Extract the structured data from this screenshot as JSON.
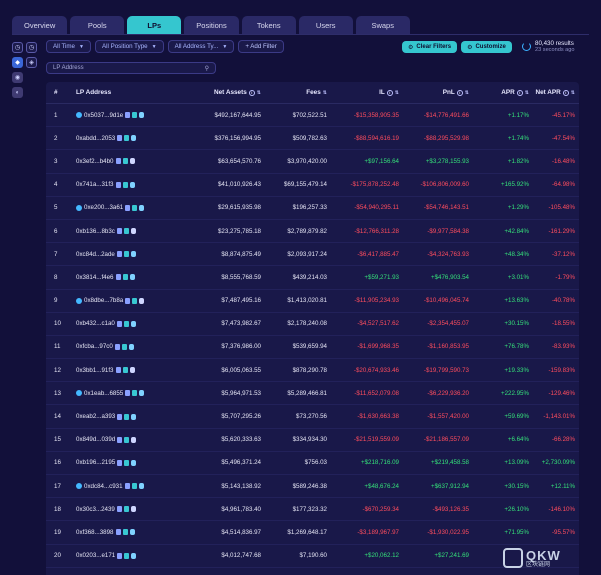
{
  "tabs": [
    "Overview",
    "Pools",
    "LPs",
    "Positions",
    "Tokens",
    "Users",
    "Swaps"
  ],
  "active_tab": "LPs",
  "filters": {
    "time": "All Time",
    "position_type": "All Position Type",
    "address_type": "All Address Ty...",
    "add_filter": "+ Add Filter",
    "clear": "Clear Filters",
    "customize": "Customize"
  },
  "results": {
    "count": "80,430 results",
    "ago": "23 seconds ago"
  },
  "search": {
    "placeholder": "LP Address"
  },
  "table": {
    "headers": {
      "num": "#",
      "addr": "LP Address",
      "net": "Net Assets",
      "fees": "Fees",
      "il": "IL",
      "pnl": "PnL",
      "apr": "APR",
      "napr": "Net APR"
    },
    "rows": [
      {
        "n": "1",
        "addr": "0x5037...9d1e",
        "net": "$492,167,644.95",
        "fees": "$702,522.51",
        "il": "-$15,358,905.35",
        "pnl": "-$14,776,491.66",
        "apr": "+1.17%",
        "napr": "-45.17%"
      },
      {
        "n": "2",
        "addr": "0xabdd...2053",
        "net": "$376,156,994.95",
        "fees": "$509,782.63",
        "il": "-$88,594,616.19",
        "pnl": "-$88,295,529.98",
        "apr": "+1.74%",
        "napr": "-47.54%"
      },
      {
        "n": "3",
        "addr": "0x3ef2...b4b0",
        "net": "$63,654,570.76",
        "fees": "$3,970,420.00",
        "il": "+$97,156.64",
        "pnl": "+$3,278,155.93",
        "apr": "+1.82%",
        "napr": "-16.48%"
      },
      {
        "n": "4",
        "addr": "0x741a...31f3",
        "net": "$41,010,926.43",
        "fees": "$69,155,479.14",
        "il": "-$175,878,252.48",
        "pnl": "-$106,806,009.60",
        "apr": "+165.92%",
        "napr": "-64.98%"
      },
      {
        "n": "5",
        "addr": "0xe200...3a61",
        "net": "$29,615,935.98",
        "fees": "$196,257.33",
        "il": "-$54,940,295.11",
        "pnl": "-$54,746,143.51",
        "apr": "+1.29%",
        "napr": "-105.48%"
      },
      {
        "n": "6",
        "addr": "0xb136...8b3c",
        "net": "$23,275,785.18",
        "fees": "$2,789,879.82",
        "il": "-$12,766,311.28",
        "pnl": "-$9,977,584.38",
        "apr": "+42.84%",
        "napr": "-161.29%"
      },
      {
        "n": "7",
        "addr": "0xc84d...2ade",
        "net": "$8,874,875.49",
        "fees": "$2,093,917.24",
        "il": "-$6,417,885.47",
        "pnl": "-$4,324,763.93",
        "apr": "+48.34%",
        "napr": "-37.12%"
      },
      {
        "n": "8",
        "addr": "0x3814...f4e6",
        "net": "$8,555,768.59",
        "fees": "$439,214.03",
        "il": "+$59,271.93",
        "pnl": "+$476,903.54",
        "apr": "+3.01%",
        "napr": "-1.79%"
      },
      {
        "n": "9",
        "addr": "0x8dbe...7b8a",
        "net": "$7,487,495.16",
        "fees": "$1,413,020.81",
        "il": "-$11,905,234.93",
        "pnl": "-$10,496,045.74",
        "apr": "+13.63%",
        "napr": "-40.78%"
      },
      {
        "n": "10",
        "addr": "0xb432...c1a0",
        "net": "$7,473,982.67",
        "fees": "$2,178,240.08",
        "il": "-$4,527,517.62",
        "pnl": "-$2,354,455.07",
        "apr": "+30.15%",
        "napr": "-18.55%"
      },
      {
        "n": "11",
        "addr": "0xfcba...97c0",
        "net": "$7,376,986.00",
        "fees": "$539,659.94",
        "il": "-$1,699,968.35",
        "pnl": "-$1,160,853.95",
        "apr": "+76.78%",
        "napr": "-83.93%"
      },
      {
        "n": "12",
        "addr": "0x3bb1...91f3",
        "net": "$6,005,063.55",
        "fees": "$878,290.78",
        "il": "-$20,674,933.46",
        "pnl": "-$19,799,590.73",
        "apr": "+19.33%",
        "napr": "-159.83%"
      },
      {
        "n": "13",
        "addr": "0x1eab...6855",
        "net": "$5,964,971.53",
        "fees": "$5,289,466.81",
        "il": "-$11,652,079.08",
        "pnl": "-$6,229,936.20",
        "apr": "+222.95%",
        "napr": "-129.46%"
      },
      {
        "n": "14",
        "addr": "0xeab2...a393",
        "net": "$5,707,295.26",
        "fees": "$73,270.56",
        "il": "-$1,630,663.38",
        "pnl": "-$1,557,420.00",
        "apr": "+59.69%",
        "napr": "-1,143.01%"
      },
      {
        "n": "15",
        "addr": "0x849d...039d",
        "net": "$5,620,333.63",
        "fees": "$334,934.30",
        "il": "-$21,519,559.09",
        "pnl": "-$21,186,557.09",
        "apr": "+6.64%",
        "napr": "-66.28%"
      },
      {
        "n": "16",
        "addr": "0xb196...2195",
        "net": "$5,496,371.24",
        "fees": "$756.03",
        "il": "+$218,716.09",
        "pnl": "+$219,458.58",
        "apr": "+13.09%",
        "napr": "+2,730.09%"
      },
      {
        "n": "17",
        "addr": "0xdc84...c931",
        "net": "$5,143,138.92",
        "fees": "$589,246.38",
        "il": "+$48,676.24",
        "pnl": "+$637,912.94",
        "apr": "+30.15%",
        "napr": "+12.11%"
      },
      {
        "n": "18",
        "addr": "0x30c3...2439",
        "net": "$4,961,783.40",
        "fees": "$177,323.32",
        "il": "-$670,259.34",
        "pnl": "-$493,126.35",
        "apr": "+26.10%",
        "napr": "-146.10%"
      },
      {
        "n": "19",
        "addr": "0xf368...3898",
        "net": "$4,514,836.97",
        "fees": "$1,269,648.17",
        "il": "-$3,189,967.97",
        "pnl": "-$1,930,022.95",
        "apr": "+71.95%",
        "napr": "-95.57%"
      },
      {
        "n": "20",
        "addr": "0x0203...e171",
        "net": "$4,012,747.68",
        "fees": "$7,190.60",
        "il": "+$20,062.12",
        "pnl": "+$27,241.69",
        "apr": "",
        "napr": ""
      }
    ]
  },
  "watermark": {
    "big": "QKW",
    "small": "区块链网"
  }
}
